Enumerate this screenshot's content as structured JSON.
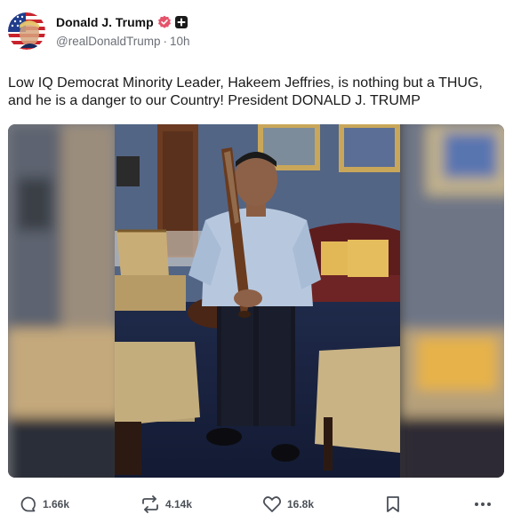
{
  "post": {
    "author": {
      "display_name": "Donald J. Trump",
      "handle": "@realDonaldTrump",
      "separator": "·",
      "time_ago": "10h",
      "avatar_icon": "american-flag-portrait"
    },
    "text": "Low IQ Democrat Minority Leader, Hakeem Jeffries, is nothing but a THUG, and he is a danger to our Country! President DONALD J. TRUMP",
    "actions": {
      "replies": "1.66k",
      "reposts": "4.14k",
      "likes": "16.8k"
    }
  },
  "colors": {
    "verified_badge": "#e5536b",
    "text_primary": "#111111",
    "text_secondary": "#6b6f76",
    "action_gray": "#4a4f57"
  },
  "icons": {
    "verified": "verified-badge-icon",
    "plus": "plus-badge-icon",
    "reply": "reply-icon",
    "repost": "repost-icon",
    "like": "heart-icon",
    "bookmark": "bookmark-icon",
    "more": "more-icon"
  }
}
